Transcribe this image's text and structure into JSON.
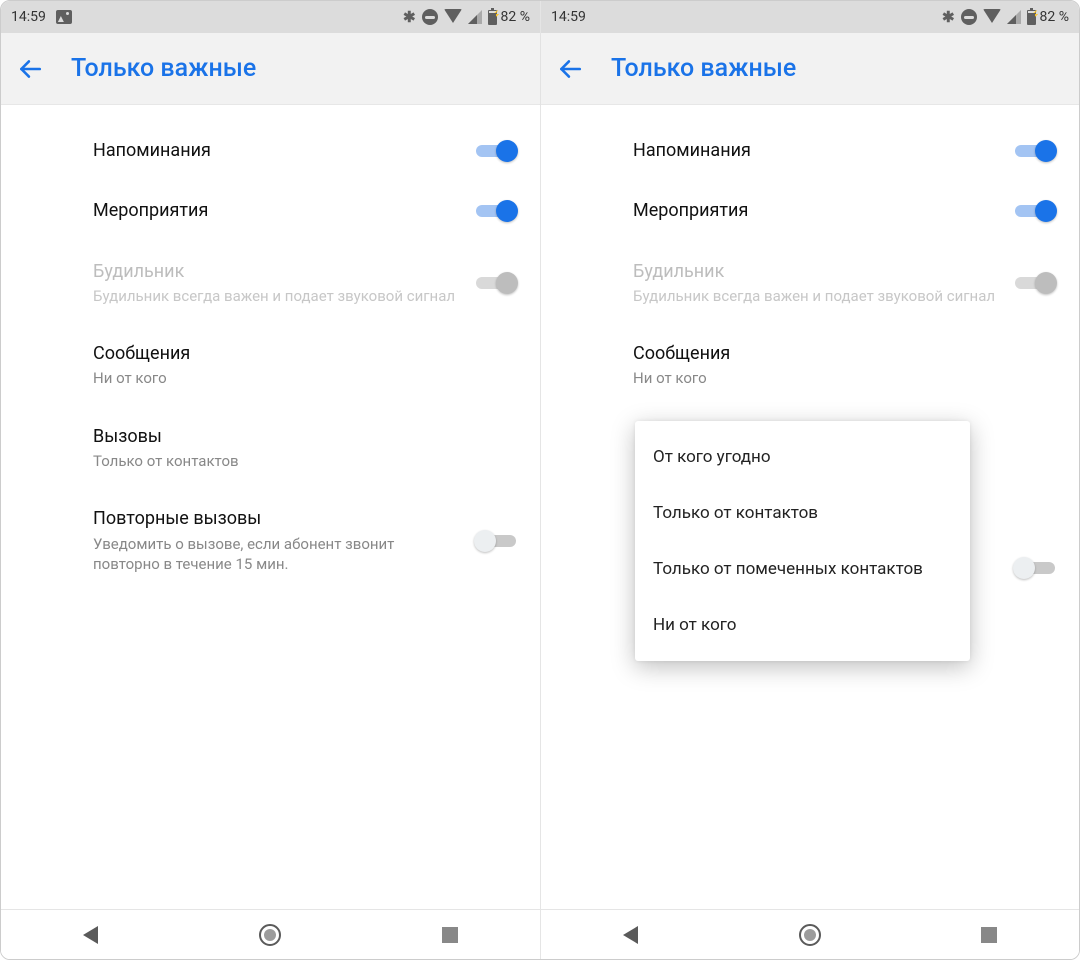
{
  "status": {
    "time": "14:59",
    "battery": "82 %"
  },
  "header": {
    "title": "Только важные"
  },
  "settings": {
    "reminders": {
      "label": "Напоминания"
    },
    "events": {
      "label": "Мероприятия"
    },
    "alarm": {
      "label": "Будильник",
      "sub": "Будильник всегда важен и подает звуковой сигнал"
    },
    "messages": {
      "label": "Сообщения",
      "sub": "Ни от кого"
    },
    "calls": {
      "label": "Вызовы",
      "sub": "Только от контактов"
    },
    "repeat": {
      "label": "Повторные вызовы",
      "sub": "Уведомить о вызове, если абонент звонит повторно в течение 15 мин."
    }
  },
  "popup": {
    "opt1": "От кого угодно",
    "opt2": "Только от контактов",
    "opt3": "Только от помеченных контактов",
    "opt4": "Ни от кого"
  }
}
